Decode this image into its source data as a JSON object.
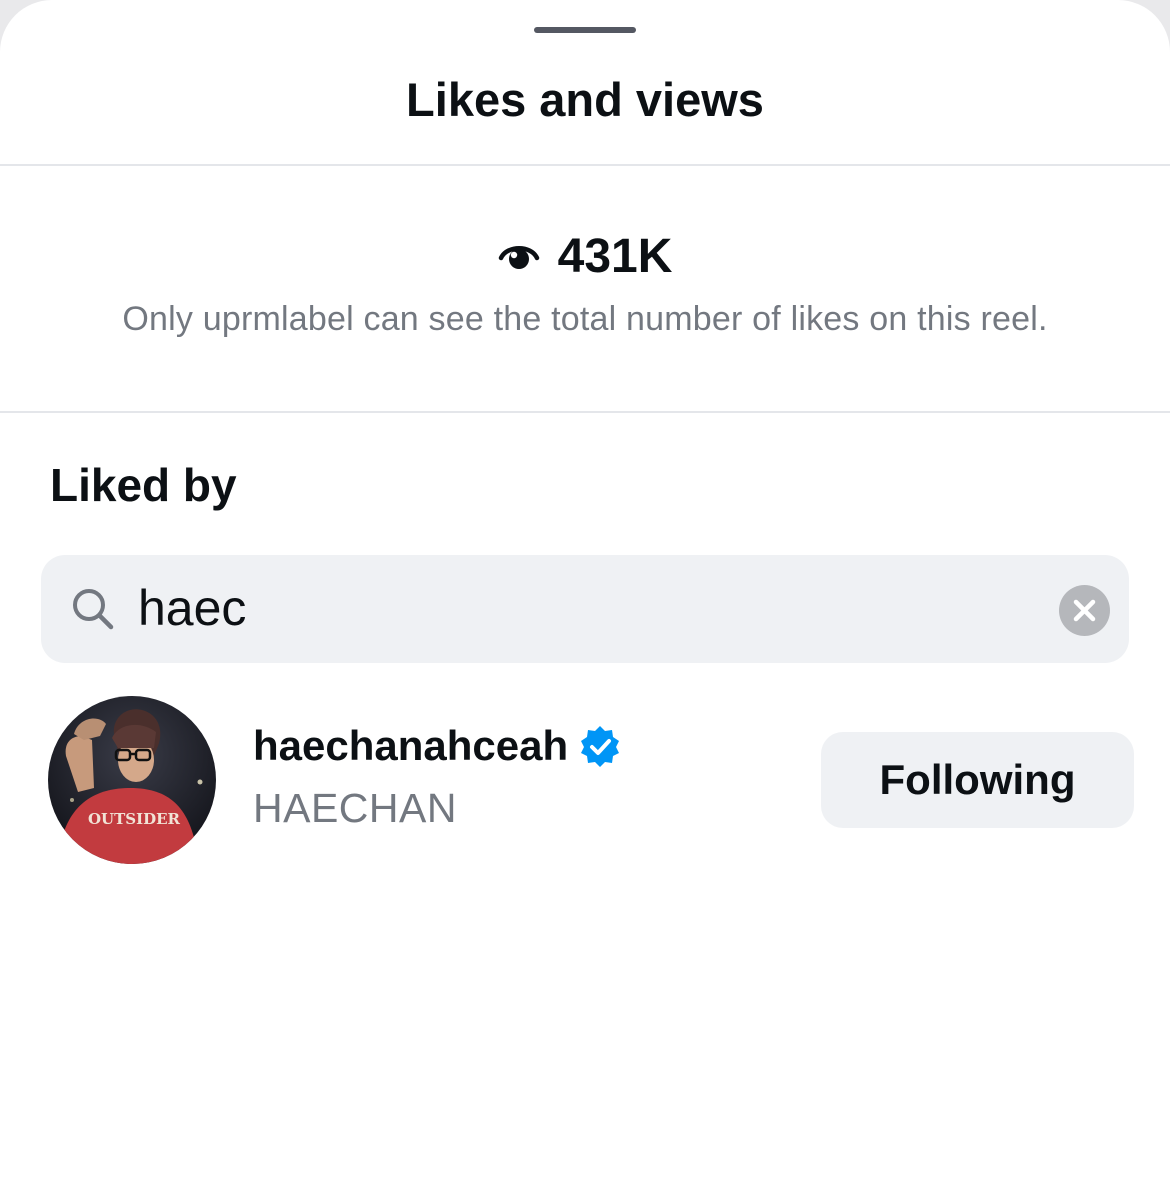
{
  "sheet": {
    "title": "Likes and views"
  },
  "views": {
    "icon": "eye-icon",
    "count": "431K",
    "note": "Only uprmlabel can see the total number of likes on this reel."
  },
  "liked_by": {
    "heading": "Liked by",
    "search": {
      "icon": "search-icon",
      "value": "haec",
      "clear_icon": "clear-search-icon"
    },
    "results": [
      {
        "username": "haechanahceah",
        "full_name": "HAECHAN",
        "verified": true,
        "avatar_shirt_text": "OUTSIDER",
        "button_label": "Following"
      }
    ]
  },
  "colors": {
    "primary_text": "#0c1014",
    "secondary_text": "#737880",
    "field_background": "#eff1f4",
    "verified_blue": "#0095f6",
    "divider": "#e4e6ea"
  }
}
